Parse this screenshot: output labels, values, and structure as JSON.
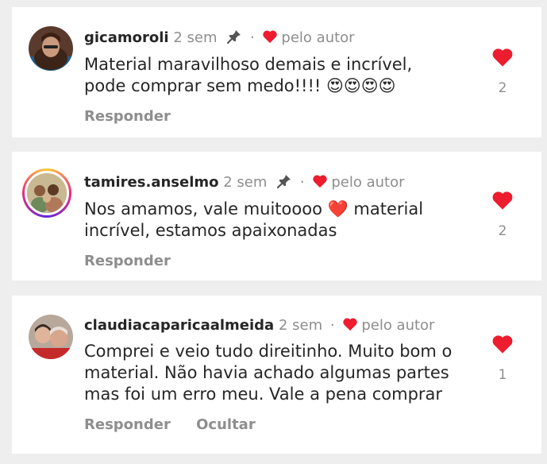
{
  "colors": {
    "heart_red": "#ed1c2e",
    "meta_grey": "#8e8e8e",
    "text_dark": "#262626"
  },
  "comments": [
    {
      "username": "gicamoroli",
      "time": "2 sem",
      "pinned": true,
      "liked_by_author": "pelo autor",
      "text": "Material maravilhoso demais e incrível, pode comprar sem medo!!!! 😍😍😍😍",
      "likes": "2",
      "actions": [
        "Responder"
      ]
    },
    {
      "username": "tamires.anselmo",
      "time": "2 sem",
      "pinned": true,
      "liked_by_author": "pelo autor",
      "text": "Nos amamos, vale muitoooo ❤️ material incrível, estamos apaixonadas",
      "likes": "2",
      "actions": [
        "Responder"
      ]
    },
    {
      "username": "claudiacaparicaalmeida",
      "time": "2 sem",
      "pinned": false,
      "liked_by_author": "pelo autor",
      "text": "Comprei e veio tudo direitinho. Muito bom o material. Não havia achado algumas partes mas foi um erro meu. Vale a pena comprar",
      "likes": "1",
      "actions": [
        "Responder",
        "Ocultar"
      ]
    }
  ]
}
